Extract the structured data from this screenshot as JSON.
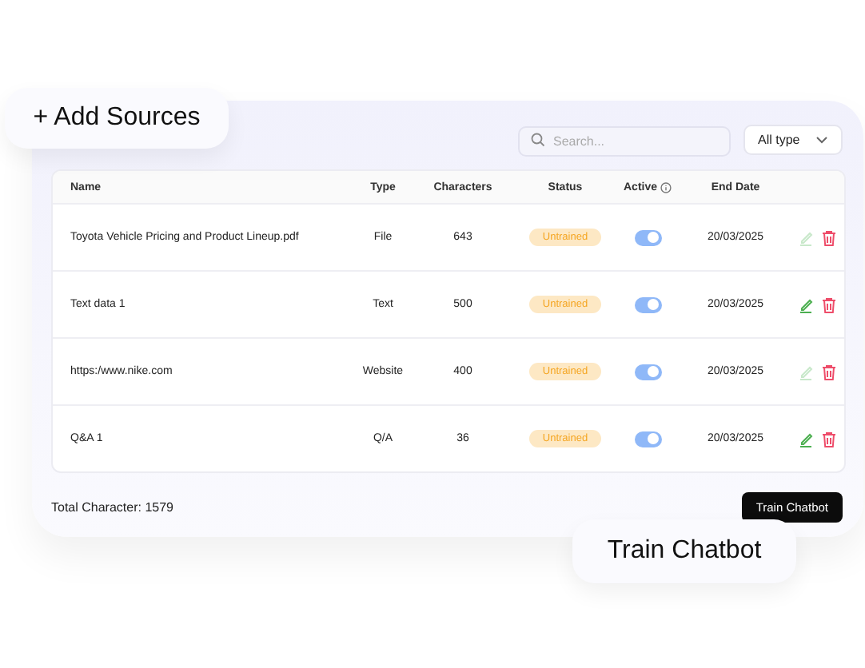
{
  "callouts": {
    "add_sources": "+ Add Sources",
    "train_chatbot": "Train Chatbot"
  },
  "search": {
    "placeholder": "Search..."
  },
  "type_filter": {
    "value": "All type"
  },
  "table": {
    "columns": [
      "Name",
      "Type",
      "Characters",
      "Status",
      "Active",
      "End Date"
    ],
    "rows": [
      {
        "name": "Toyota Vehicle Pricing and Product Lineup.pdf",
        "type": "File",
        "characters": "643",
        "status": "Untrained",
        "active": true,
        "end_date": "20/03/2025",
        "edit_disabled": true
      },
      {
        "name": "Text data 1",
        "type": "Text",
        "characters": "500",
        "status": "Untrained",
        "active": true,
        "end_date": "20/03/2025",
        "edit_disabled": false
      },
      {
        "name": "https:/www.nike.com",
        "type": "Website",
        "characters": "400",
        "status": "Untrained",
        "active": true,
        "end_date": "20/03/2025",
        "edit_disabled": true
      },
      {
        "name": "Q&A 1",
        "type": "Q/A",
        "characters": "36",
        "status": "Untrained",
        "active": true,
        "end_date": "20/03/2025",
        "edit_disabled": false
      }
    ]
  },
  "footer": {
    "total": "Total Character: 1579",
    "button": "Train Chatbot"
  }
}
